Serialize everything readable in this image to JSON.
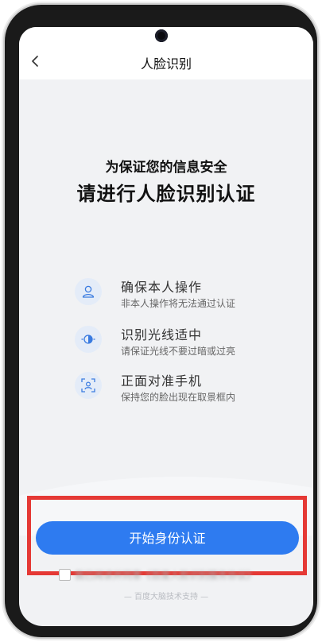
{
  "header": {
    "title": "人脸识别"
  },
  "intro": {
    "subtitle": "为保证您的信息安全",
    "title": "请进行人脸识别认证"
  },
  "tips": [
    {
      "icon": "person-icon",
      "title": "确保本人操作",
      "desc": "非本人操作将无法通过认证"
    },
    {
      "icon": "light-icon",
      "title": "识别光线适中",
      "desc": "请保证光线不要过暗或过亮"
    },
    {
      "icon": "face-frame-icon",
      "title": "正面对准手机",
      "desc": "保持您的脸出现在取景框内"
    }
  ],
  "actions": {
    "start_label": "开始身份认证",
    "agreement_text": "我已阅读并同意《百度人脸识别服务协议》"
  },
  "footer": {
    "credit": "— 百度大脑技术支持 —"
  },
  "colors": {
    "accent": "#2e7bf0",
    "highlight": "#e53935",
    "background": "#f1f2f4"
  }
}
